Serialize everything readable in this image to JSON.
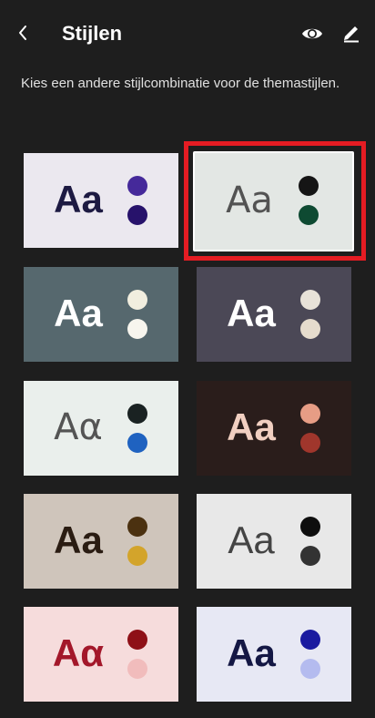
{
  "header": {
    "title": "Stijlen",
    "back_icon": "chevron-left-icon",
    "preview_icon": "eye-icon",
    "edit_icon": "pencil-icon"
  },
  "description": "Kies een andere stijlcombinatie voor de themastijlen.",
  "styles": [
    {
      "sample": "Aa",
      "bg": "#ebe8ef",
      "text_color": "#1d1a42",
      "dot1": "#45299a",
      "dot2": "#27126b",
      "weight": "bold",
      "selected": false
    },
    {
      "sample": "Aa",
      "bg": "#e3e7e4",
      "text_color": "#444444",
      "dot1": "#151515",
      "dot2": "#0e4a32",
      "weight": "light",
      "selected": true
    },
    {
      "sample": "Aa",
      "bg": "#56686e",
      "text_color": "#ffffff",
      "dot1": "#f1eedf",
      "dot2": "#f7f5ee",
      "weight": "bold",
      "selected": false
    },
    {
      "sample": "Aa",
      "bg": "#4b4856",
      "text_color": "#ffffff",
      "dot1": "#e8e2d8",
      "dot2": "#e6dccd",
      "weight": "bold",
      "selected": false
    },
    {
      "sample": "Aα",
      "bg": "#eaefec",
      "text_color": "#444444",
      "dot1": "#1a2222",
      "dot2": "#1f62c0",
      "weight": "light",
      "selected": false
    },
    {
      "sample": "Aa",
      "bg": "#2a1d1b",
      "text_color": "#f1cfc1",
      "dot1": "#e79d85",
      "dot2": "#a0362c",
      "weight": "bold",
      "selected": false
    },
    {
      "sample": "Aa",
      "bg": "#cfc5bb",
      "text_color": "#2a1c12",
      "dot1": "#4b3110",
      "dot2": "#d3a42b",
      "weight": "bold",
      "selected": false
    },
    {
      "sample": "Aa",
      "bg": "#e8e8e8",
      "text_color": "#444444",
      "dot1": "#0e0e0e",
      "dot2": "#333333",
      "weight": "normal",
      "selected": false
    },
    {
      "sample": "Aα",
      "bg": "#f6dcdc",
      "text_color": "#a3172a",
      "dot1": "#8e1017",
      "dot2": "#f1bcbc",
      "weight": "bold",
      "selected": false
    },
    {
      "sample": "Aa",
      "bg": "#e7e8f4",
      "text_color": "#141744",
      "dot1": "#1a1aa0",
      "dot2": "#b4bbef",
      "weight": "bold",
      "selected": false
    }
  ],
  "colors": {
    "background": "#1e1e1e",
    "selection_highlight": "#e51c23"
  }
}
